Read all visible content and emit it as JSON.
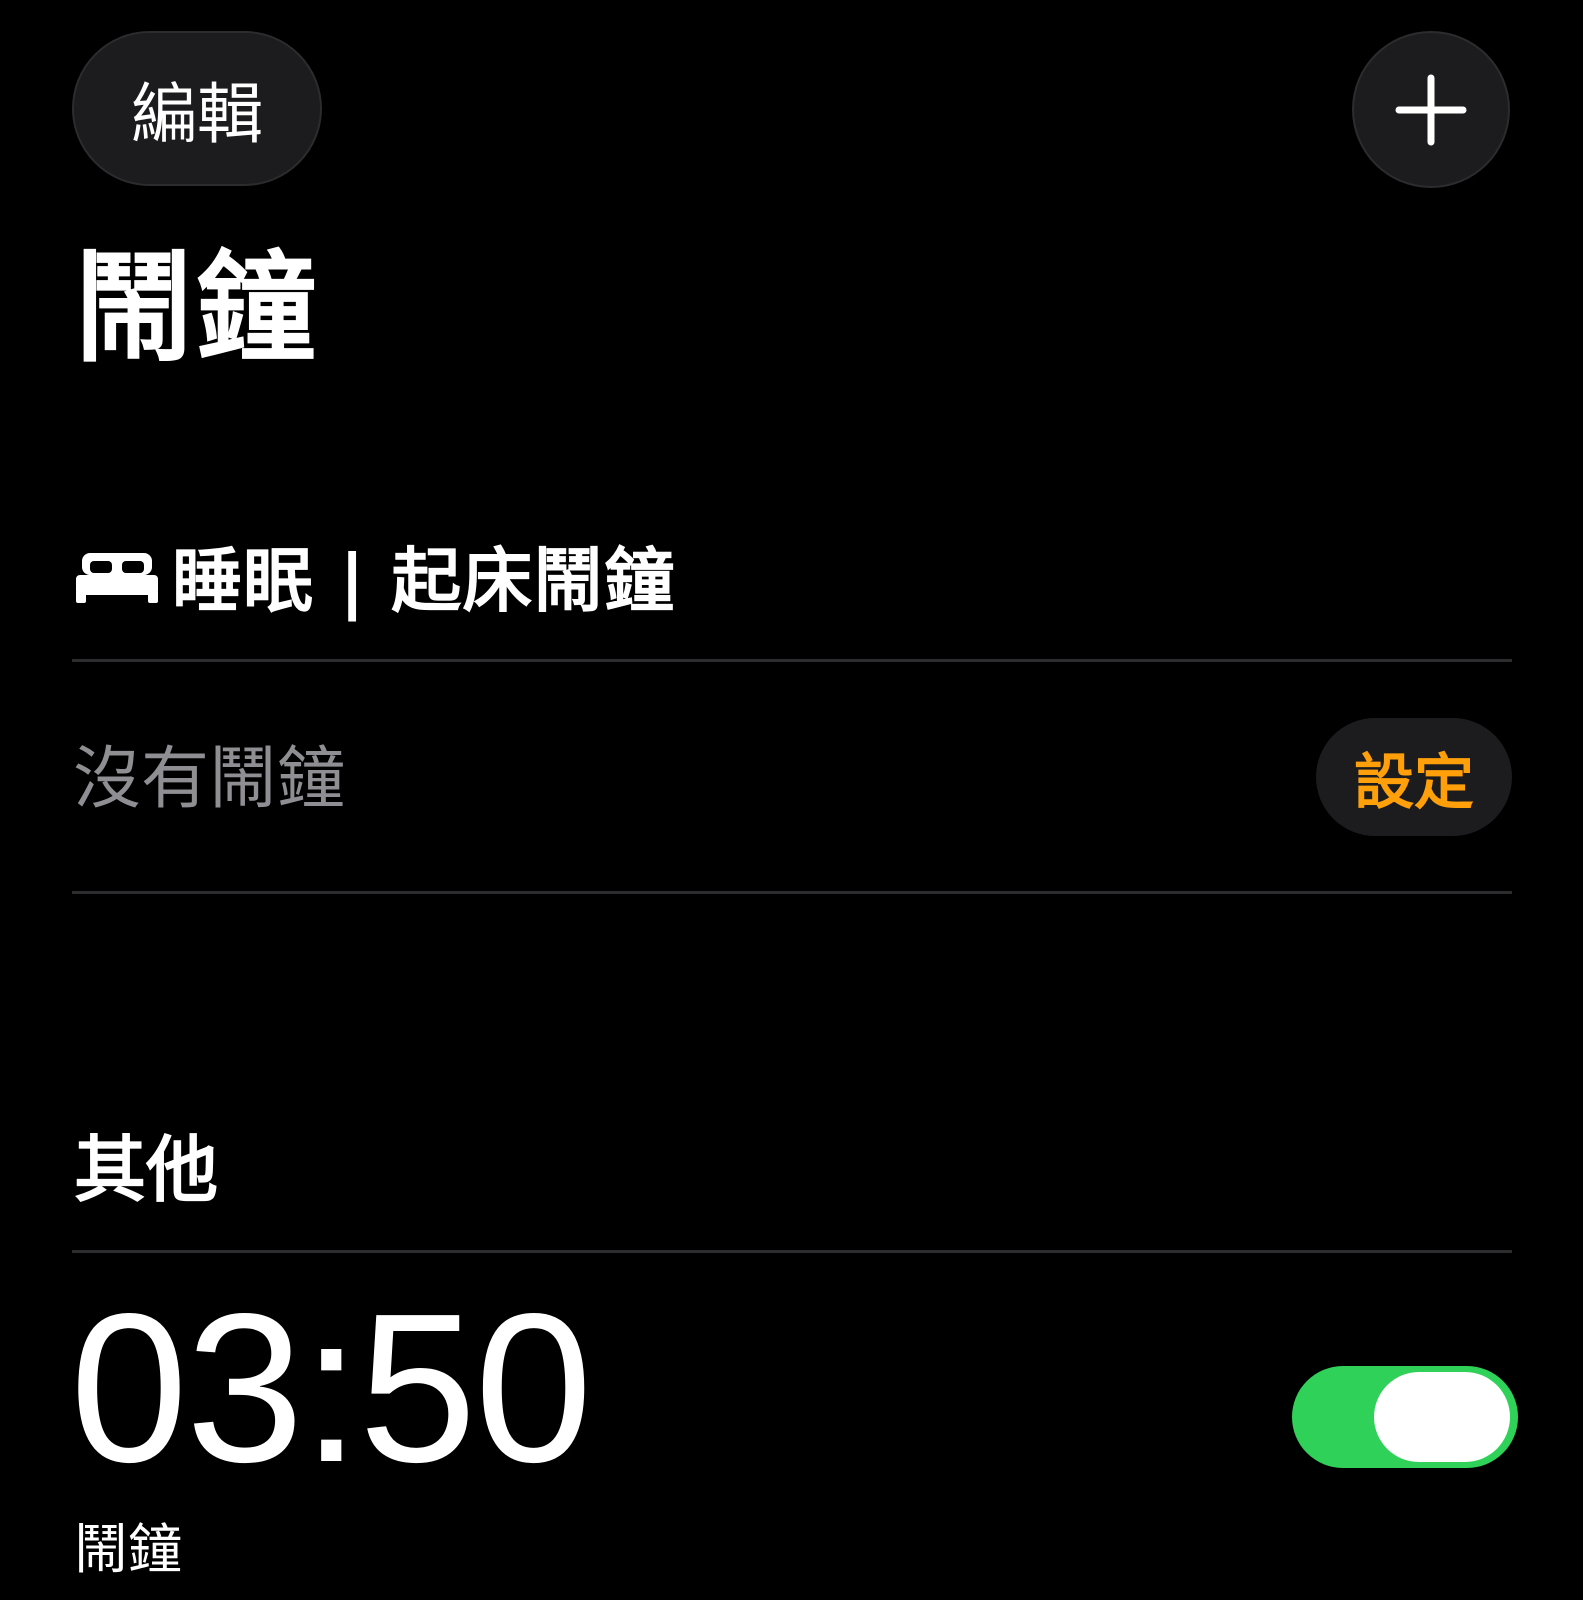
{
  "toolbar": {
    "edit_label": "編輯",
    "add_icon": "plus-icon"
  },
  "title": "鬧鐘",
  "sleep": {
    "icon": "bed-icon",
    "header": "睡眠 | 起床鬧鐘",
    "empty_text": "沒有鬧鐘",
    "set_label": "設定"
  },
  "other": {
    "header": "其他",
    "alarms": [
      {
        "time": "03:50",
        "label": "鬧鐘",
        "enabled": true
      }
    ]
  },
  "colors": {
    "background": "#000000",
    "accent_orange": "#ff9f0a",
    "toggle_on": "#30d158",
    "secondary_text": "#8e8e93",
    "button_bg": "#1c1c1e"
  }
}
